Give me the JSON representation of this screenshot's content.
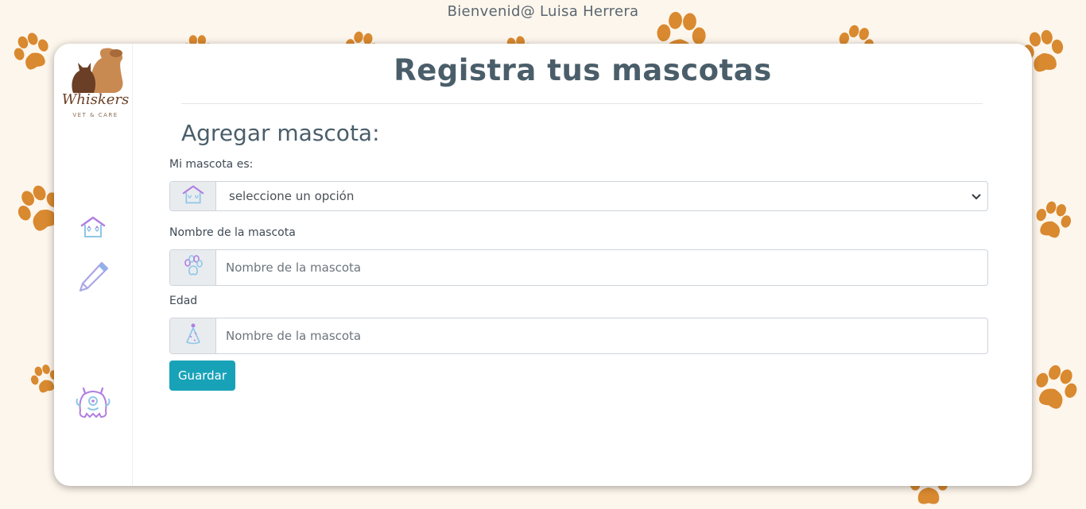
{
  "header": {
    "welcome": "Bienvenid@ Luisa Herrera"
  },
  "brand": {
    "name": "Whiskers",
    "tagline": "VET & CARE"
  },
  "sidebar": {
    "items": [
      {
        "icon": "pet-house-icon"
      },
      {
        "icon": "pencil-icon"
      },
      {
        "icon": "monster-icon"
      }
    ]
  },
  "main": {
    "title": "Registra tus mascotas",
    "section_title": "Agregar mascota:",
    "form": {
      "pet_type": {
        "label": "Mi mascota es:",
        "selected": "seleccione un opción",
        "icon": "pet-house-icon"
      },
      "pet_name": {
        "label": "Nombre de la mascota",
        "placeholder": "Nombre de la mascota",
        "icon": "paw-icon"
      },
      "age": {
        "label": "Edad",
        "placeholder": "Nombre de la mascota",
        "icon": "party-hat-icon"
      },
      "save_label": "Guardar"
    }
  },
  "colors": {
    "background": "#fdf6ec",
    "paw": "#d9892f",
    "title": "#4a5e6a",
    "button": "#17a2b8"
  }
}
